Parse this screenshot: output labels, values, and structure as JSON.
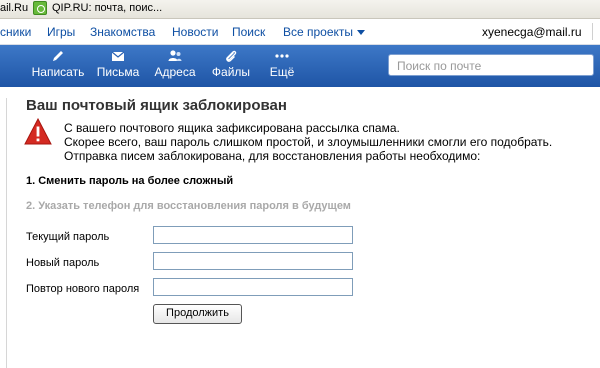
{
  "browser_tabs": [
    {
      "label": "ail.Ru",
      "icon": "none"
    },
    {
      "label": "QIP.RU: почта, поис...",
      "icon": "qip-icon"
    }
  ],
  "portal_nav": {
    "links": [
      "сники",
      "Игры",
      "Знакомства",
      "Новости",
      "Поиск",
      "Все проекты"
    ],
    "user_email": "xyenecga@mail.ru"
  },
  "toolbar": {
    "buttons": [
      {
        "label": "Написать",
        "icon": "pencil-icon"
      },
      {
        "label": "Письма",
        "icon": "envelope-icon"
      },
      {
        "label": "Адреса",
        "icon": "contacts-icon"
      },
      {
        "label": "Файлы",
        "icon": "paperclip-icon"
      },
      {
        "label": "Ещё",
        "icon": "more-dots-icon"
      }
    ],
    "search_placeholder": "Поиск по почте"
  },
  "notice": {
    "title": "Ваш почтовый ящик заблокирован",
    "lines": [
      "С вашего почтового ящика зафиксирована рассылка спама.",
      "Скорее всего, ваш пароль слишком простой, и злоумышленники смогли его подобрать.",
      "Отправка писем заблокирована, для восстановления работы необходимо:"
    ],
    "step1": "1. Сменить пароль на более сложный",
    "step2": "2. Указать телефон для восстановления пароля в будущем"
  },
  "form": {
    "fields": [
      {
        "label": "Текущий пароль",
        "value": ""
      },
      {
        "label": "Новый пароль",
        "value": ""
      },
      {
        "label": "Повтор нового пароля",
        "value": ""
      }
    ],
    "submit_label": "Продолжить"
  },
  "colors": {
    "toolbar": "#2a62b4",
    "link": "#0e4fa3",
    "warning": "#d42a22",
    "step_disabled": "#a9a9a9"
  }
}
